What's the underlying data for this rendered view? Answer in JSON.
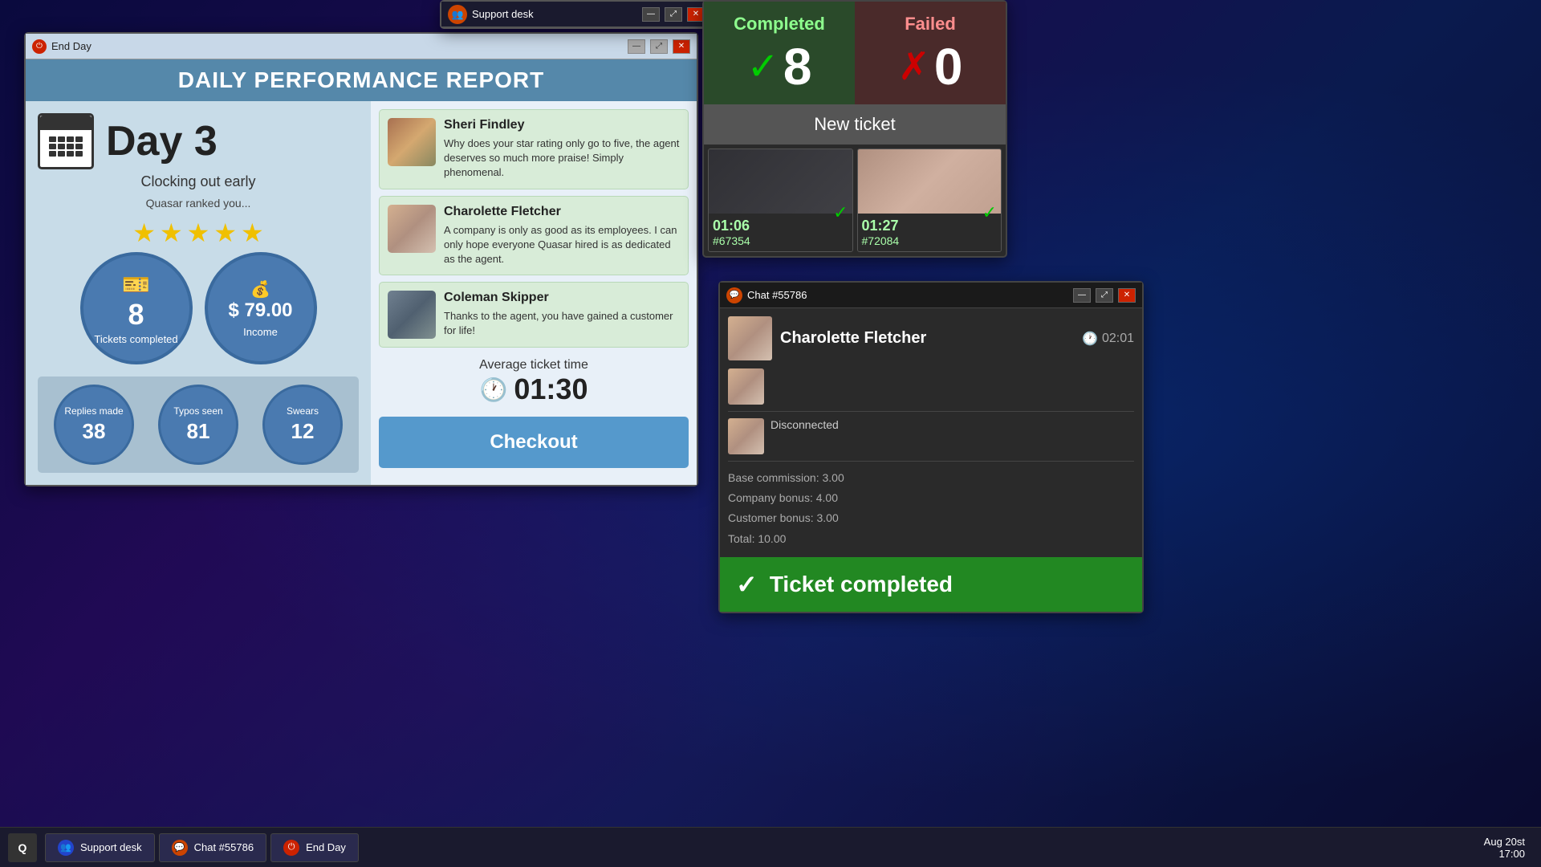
{
  "taskbar": {
    "logo": "Q",
    "items": [
      {
        "id": "support-desk",
        "label": "Support desk",
        "icon": "👥",
        "icon_color": "blue"
      },
      {
        "id": "chat-55786",
        "label": "Chat #55786",
        "icon": "💬",
        "icon_color": "orange"
      },
      {
        "id": "end-day",
        "label": "End Day",
        "icon": "⏻",
        "icon_color": "red"
      }
    ],
    "date": "Aug 20st",
    "time": "17:00"
  },
  "end_day_window": {
    "title": "End Day",
    "report_title": "DAILY PERFORMANCE REPORT",
    "day_number": "Day 3",
    "day_subtitle": "Clocking out early",
    "quasar_label": "Quasar ranked you...",
    "stars": 5,
    "tickets_completed": "8",
    "tickets_label": "Tickets completed",
    "income": "$ 79.00",
    "income_label": "Income",
    "replies_label": "Replies made",
    "replies_value": "38",
    "typos_label": "Typos seen",
    "typos_value": "81",
    "swears_label": "Swears",
    "swears_value": "12",
    "avg_label": "Average ticket time",
    "avg_time": "01:30",
    "checkout_label": "Checkout",
    "reviews": [
      {
        "name": "Sheri Findley",
        "text": "Why does your star rating only go to five,  the agent deserves so much more praise! Simply phenomenal.",
        "avatar_type": "cat"
      },
      {
        "name": "Charolette Fletcher",
        "text": "A company is only as good as its employees. I can only hope everyone Quasar hired is as dedicated as  the agent.",
        "avatar_type": "girl"
      },
      {
        "name": "Coleman Skipper",
        "text": "Thanks to  the agent, you have gained a customer for life!",
        "avatar_type": "guy"
      }
    ]
  },
  "support_desk_window": {
    "title": "Support desk"
  },
  "stats_window": {
    "completed_label": "Completed",
    "completed_value": "8",
    "failed_label": "Failed",
    "failed_value": "0",
    "new_ticket_label": "New ticket",
    "tickets": [
      {
        "time": "01:06",
        "id": "#67354",
        "avatar_type": "dark"
      },
      {
        "time": "01:27",
        "id": "#72084",
        "avatar_type": "glasses"
      }
    ]
  },
  "chat_window": {
    "title": "Chat #55786",
    "username": "Charolette Fletcher",
    "time": "02:01",
    "disconnected_text": "Disconnected",
    "payment": {
      "base": "Base commission: 3.00",
      "company": "Company bonus: 4.00",
      "customer": "Customer bonus: 3.00",
      "total": "Total: 10.00"
    },
    "completed_label": "Ticket completed"
  }
}
